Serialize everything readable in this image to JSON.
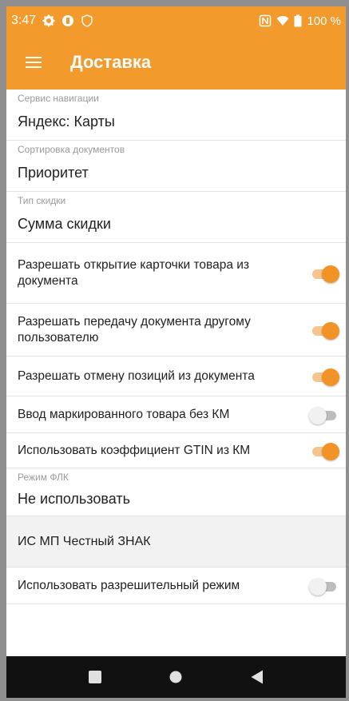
{
  "status_bar": {
    "time": "3:47",
    "battery": "100 %"
  },
  "app_bar": {
    "title": "Доставка",
    "menu_icon": "hamburger-menu-icon"
  },
  "settings": {
    "nav_service": {
      "caption": "Сервис навигации",
      "value": "Яндекс: Карты"
    },
    "doc_sorting": {
      "caption": "Сортировка документов",
      "value": "Приоритет"
    },
    "discount_type": {
      "caption": "Тип скидки",
      "value": "Сумма скидки"
    },
    "switches": [
      {
        "label": "Разрешать открытие карточки товара из документа",
        "on": true
      },
      {
        "label": "Разрешать передачу документа другому пользователю",
        "on": true
      },
      {
        "label": "Разрешать отмену позиций из документа",
        "on": true
      },
      {
        "label": "Ввод маркированного товара без КМ",
        "on": false
      },
      {
        "label": "Использовать коэффициент GTIN из КМ",
        "on": true
      }
    ],
    "flk_mode": {
      "caption": "Режим ФЛК",
      "value": "Не использовать"
    },
    "section_title": "ИС МП Честный ЗНАК",
    "permissive_mode": {
      "label": "Использовать разрешительный режим",
      "on": false
    }
  },
  "colors": {
    "accent": "#f39a2d",
    "switch_on_thumb": "#f29325",
    "switch_on_track": "#f6c58f",
    "navbar": "#111111"
  },
  "nav_bar": {
    "recents_icon": "square-recents-icon",
    "home_icon": "circle-home-icon",
    "back_icon": "triangle-back-icon"
  }
}
